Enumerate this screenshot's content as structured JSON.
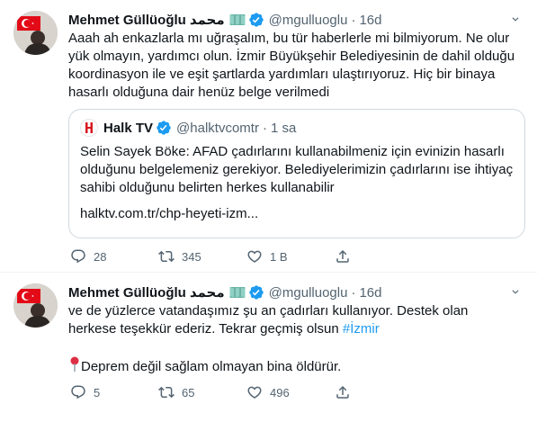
{
  "tweets": [
    {
      "name": "Mehmet Güllüoğlu",
      "name_arabic": "محمد",
      "handle": "@mgulluoglu",
      "time": "16d",
      "text": "Aaah ah enkazlarla mı uğraşalım, bu tür haberlerle mi bilmiyorum. Ne olur yük olmayın, yardımcı olun. İzmir Büyükşehir Belediyesinin de dahil olduğu koordinasyon ile ve eşit şartlarda yardımları ulaştırıyoruz. Hiç bir binaya hasarlı olduğuna dair henüz belge verilmedi",
      "quote": {
        "name": "Halk TV",
        "handle": "@halktvcomtr",
        "time": "1 sa",
        "text": "Selin Sayek Böke: AFAD çadırlarını kullanabilmeniz için evinizin hasarlı olduğunu belgelemeniz gerekiyor. Belediyelerimizin çadırlarını ise ihtiyaç sahibi olduğunu belirten herkes kullanabilir",
        "link": "halktv.com.tr/chp-heyeti-izm..."
      },
      "replies": "28",
      "retweets": "345",
      "likes": "1 B"
    },
    {
      "name": "Mehmet Güllüoğlu",
      "name_arabic": "محمد",
      "handle": "@mgulluoglu",
      "time": "16d",
      "text_main": "ve de yüzlerce vatandaşımız şu an çadırları kullanıyor. Destek olan herkese teşekkür ederiz. Tekrar geçmiş olsun ",
      "hashtag": "#İzmir",
      "text_pin": "Deprem değil sağlam olmayan bina öldürür.",
      "replies": "5",
      "retweets": "65",
      "likes": "496"
    }
  ],
  "colors": {
    "accent": "#1d9bf0",
    "secondary_text": "#536471",
    "border": "#cfd9de",
    "halktv_red": "#d71920"
  },
  "icons": [
    "more-icon",
    "verified-icon",
    "map-emoji-icon",
    "reply-icon",
    "retweet-icon",
    "like-icon",
    "share-icon",
    "pin-emoji-icon",
    "halktv-logo-icon"
  ]
}
